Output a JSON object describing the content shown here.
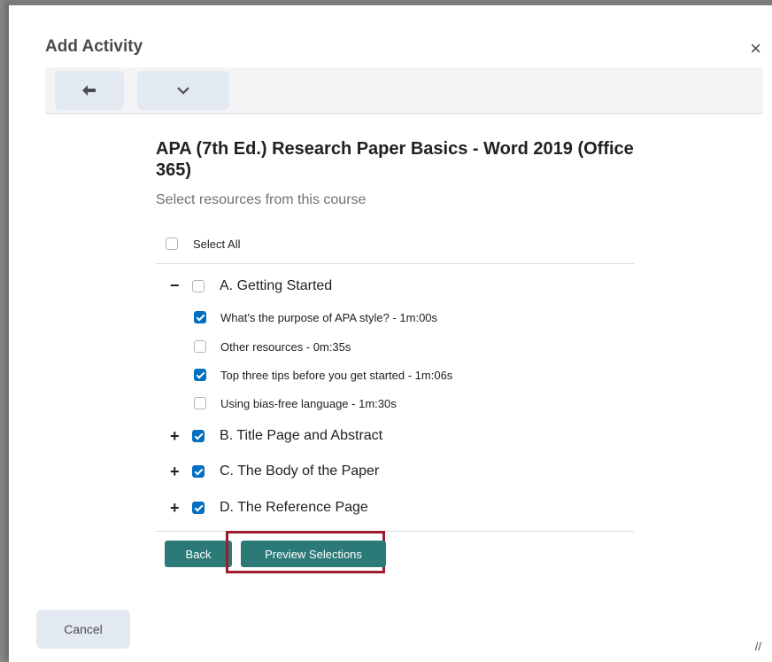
{
  "dialog": {
    "title": "Add Activity",
    "close_icon": "×",
    "resize_icon": "//"
  },
  "toolbar": {
    "back_icon": "arrow-left-icon",
    "dropdown_icon": "chevron-down-icon"
  },
  "course": {
    "title": "APA (7th Ed.) Research Paper Basics - Word 2019 (Office 365)",
    "subtitle": "Select resources from this course"
  },
  "select_all": {
    "label": "Select All",
    "checked": false
  },
  "sections": [
    {
      "label": "A. Getting Started",
      "expanded": true,
      "checked": false,
      "toggle": "−",
      "items": [
        {
          "label": "What's the purpose of APA style? - 1m:00s",
          "checked": true
        },
        {
          "label": "Other resources - 0m:35s",
          "checked": false
        },
        {
          "label": "Top three tips before you get started - 1m:06s",
          "checked": true
        },
        {
          "label": "Using bias-free language - 1m:30s",
          "checked": false
        }
      ]
    },
    {
      "label": "B. Title Page and Abstract",
      "expanded": false,
      "checked": true,
      "toggle": "+"
    },
    {
      "label": "C. The Body of the Paper",
      "expanded": false,
      "checked": true,
      "toggle": "+"
    },
    {
      "label": "D. The Reference Page",
      "expanded": false,
      "checked": true,
      "toggle": "+"
    }
  ],
  "actions": {
    "back": "Back",
    "preview": "Preview Selections",
    "cancel": "Cancel"
  },
  "colors": {
    "primary": "#2b7a78",
    "checkbox": "#006fbf",
    "highlight": "#9b1c2a"
  }
}
